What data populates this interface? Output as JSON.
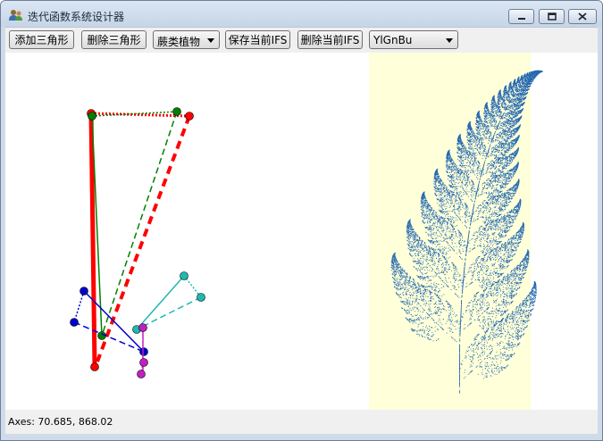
{
  "window": {
    "title": "迭代函数系统设计器",
    "icon": "users-icon"
  },
  "toolbar": {
    "add_triangle_label": "添加三角形",
    "delete_triangle_label": "删除三角形",
    "preset_selected": "蕨类植物",
    "save_ifs_label": "保存当前IFS",
    "delete_ifs_label": "删除当前IFS",
    "colormap_selected": "YlGnBu"
  },
  "status": {
    "axes_text": "Axes: 70.685, 868.02"
  },
  "colors": {
    "triangle_red": "#ff0000",
    "triangle_green": "#008000",
    "triangle_blue": "#0000cc",
    "triangle_cyan": "#1fb8b0",
    "triangle_magenta": "#c020c0",
    "fractal_background": "#ffffd9",
    "fractal_fern": "#2468b0"
  }
}
